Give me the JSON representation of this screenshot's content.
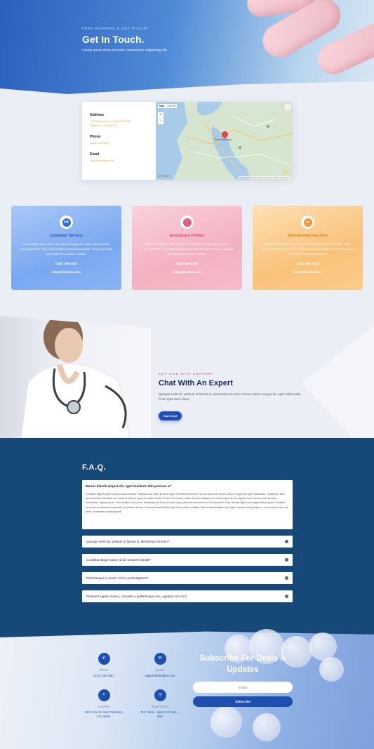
{
  "hero": {
    "eyebrow": "FREE SHIPPING & 24/7 PICKUP",
    "title": "Get In Touch.",
    "subtitle": "Lorem ipsum dolor sit amet, consectetur adipiscing elit."
  },
  "contact": {
    "address_label": "Address",
    "address_value": "123 Pharmacy St, Suite 800 San Francisco, CA 94105",
    "phone_label": "Phone",
    "phone_value": "(123) 234-3467",
    "email_label": "Email",
    "email_value": "help@diviphar.com"
  },
  "map": {
    "map_tab": "Map",
    "satellite_tab": "Satellite",
    "zoom_in": "+",
    "zoom_out": "−",
    "fullscreen": "⛶",
    "city_label": "San Francisco",
    "google_logo": "Google",
    "footer_text": "Map data ©2018 Google  Terms of Use  Report a map error"
  },
  "services": [
    {
      "title": "Customer Service",
      "text": "Sed porttitor lectus nibh. Cras ultricies ligula sed magna dictum porta. Proin eget tortor risus. Nulla porttitor accumsan tincidunt. Vivamus suscipit tortor eget felis porttitor volutpat.",
      "phone": "(543) 295-2393",
      "email": "help@diviphar.com",
      "icon": "thumbs-up-icon",
      "color": "#3f7fe0"
    },
    {
      "title": "Emergency Hotline",
      "text": "Sed porttitor lectus nibh. Cras ultricies ligula sed magna dictum porta. Proin eget tortor risus. Nulla porttitor accumsan tincidunt. Vivamus suscipit tortor eget felis porttitor volutpat.",
      "phone": "(543) 295-2393",
      "email": "help@diviphar.com",
      "icon": "alert-icon",
      "color": "#e5587a"
    },
    {
      "title": "Membership Inquiries",
      "text": "Sed porttitor lectus nibh. Cras ultricies ligula sed magna dictum porta. Proin eget tortor risus. Nulla porttitor accumsan tincidunt. Vivamus suscipit tortor eget felis porttitor volutpat.",
      "phone": "(543) 295-2393",
      "email": "help@diviphar.com",
      "icon": "card-icon",
      "color": "#f4962f"
    }
  ],
  "chat": {
    "eyebrow": "24/7 LIVE CHAT SUPPORT",
    "title": "Chat With An Expert",
    "text": "Quisque velit nisi, pretium ut lacinia in, elementum id enim. Donec rutrum congue leo eget malesuada. Proin eget tortor risus.",
    "button": "Start Chat"
  },
  "faq": {
    "title": "F.A.Q.",
    "open_question": "Mauris blandit aliquet elit, eget tincidunt nibh pulvinar a?",
    "open_answer": "Curabitur aliquet quam id dui posuere blandit. Vestibulum ac diam sit amet quam vehicula elementum sed sit amet dui. Donec rutrum congue leo eget malesuada. Vestibulum ante ipsum primis in faucibus orci luctus et ultrices posuere cubilia Curae; Donec velit neque, auctor sit amet aliquam vel, ullamcorper sit amet ligula. Lorem ipsum dolor sit amet, consectetur adipiscing elit. Sed porttitor lectus nibh. Vestibulum ac diam sit amet quam vehicula elementum sed sit amet dui. Cras ultricies ligula sed magna dictum porta. Curabitur arcu erat, accumsan id imperdiet et, porttitor at sem. Vivamus suscipit tortor eget felis porttitor volutpat. Mauris blandit aliquet elit, eget tincidunt nibh pulvinar a. Lorem ipsum dolor sit amet, consectetur adipiscing elit.",
    "items": [
      "Quisque velit nisi, pretium ut lacinia in, elementum id enim?",
      "Curabitur aliquet quam id dui posuere blandit?",
      "Pellentesque in ipsum id orci porta dapibus?",
      "Praesent sapien massa, convallis a pellentesque nec, egestas non nisi?"
    ]
  },
  "footer": {
    "phone_label": "Phone",
    "phone_value": "(234) 234-3467",
    "email_label": "Email",
    "email_value": "support@diviphar.com",
    "location_label": "Location",
    "location_value": "1343 21st St. San Francisco, Ca 29456",
    "hours_label": "Store Hours",
    "hours_value": "M-F: 8am – 5pm S-S: 9am – 4pm",
    "subscribe_title": "Subscribe For Deals & Updates",
    "email_placeholder": "Email",
    "subscribe_button": "Subscribe"
  }
}
